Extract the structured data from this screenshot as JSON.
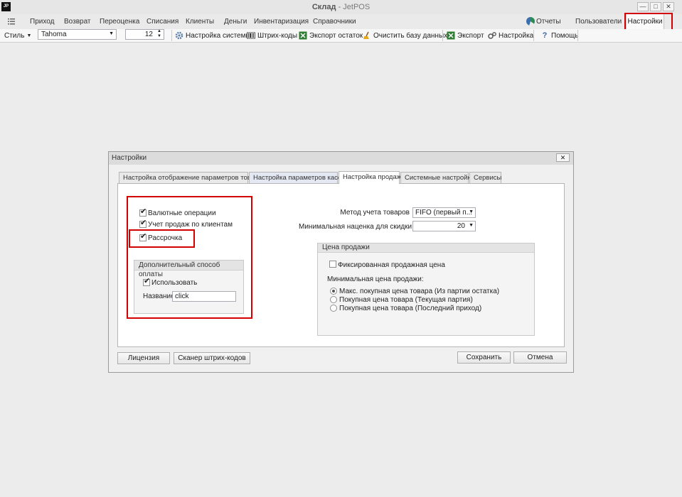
{
  "window": {
    "logo": "JP",
    "title_main": "Склад",
    "title_sep": " - ",
    "title_app": "JetPOS",
    "minimize": "—",
    "maximize": "□",
    "close": "✕"
  },
  "ribbon": {
    "menu_icon": "menu-icon",
    "tabs": [
      "Приход",
      "Возврат",
      "Переоценка",
      "Списания",
      "Клиенты",
      "Деньги",
      "Инвентаризация",
      "Справочники"
    ],
    "reports": "Отчеты",
    "users": "Пользователи",
    "settings": "Настройки"
  },
  "toolbar": {
    "style": "Стиль",
    "font": "Tahoma",
    "font_size": "12",
    "system_settings": "Настройка системы",
    "barcodes": "Штрих-коды",
    "export_stock": "Экспорт остаток",
    "clear_db": "Очистить базу данных",
    "export": "Экспорт",
    "settings": "Настройка",
    "help": "Помощь"
  },
  "dialog": {
    "title": "Настройки",
    "close": "✕",
    "tabs": [
      "Настройка отображение параметров товара",
      "Настройка параметров кассы",
      "Настройка продаж",
      "Системные настройки",
      "Сервисы"
    ],
    "active_tab": 2,
    "checks": {
      "currency": "Валютные операции",
      "client_sales": "Учет продаж по клиентам",
      "installment": "Рассрочка"
    },
    "extra_payment": {
      "title": "Дополнительный способ оплаты",
      "use": "Использовать",
      "name_label": "Название",
      "name_value": "click"
    },
    "accounting_method_label": "Метод учета товаров",
    "accounting_method_value": "FIFO (первый п...",
    "min_markup_label": "Минимальная наценка для скидки",
    "min_markup_value": "20",
    "sale_price": {
      "title": "Цена продажи",
      "fixed": "Фиксированная продажная цена",
      "min_label": "Минимальная цена продажи:",
      "options": [
        "Макс. покупная цена товара (Из партии остатка)",
        "Покупная цена товара (Текущая партия)",
        "Покупная цена товара (Последний приход)"
      ],
      "selected": 0
    },
    "buttons": {
      "license": "Лицензия",
      "barcode_scanner": "Сканер штрих-кодов",
      "save": "Сохранить",
      "cancel": "Отмена"
    }
  },
  "colors": {
    "highlight": "#d40000",
    "background": "#ececed"
  }
}
